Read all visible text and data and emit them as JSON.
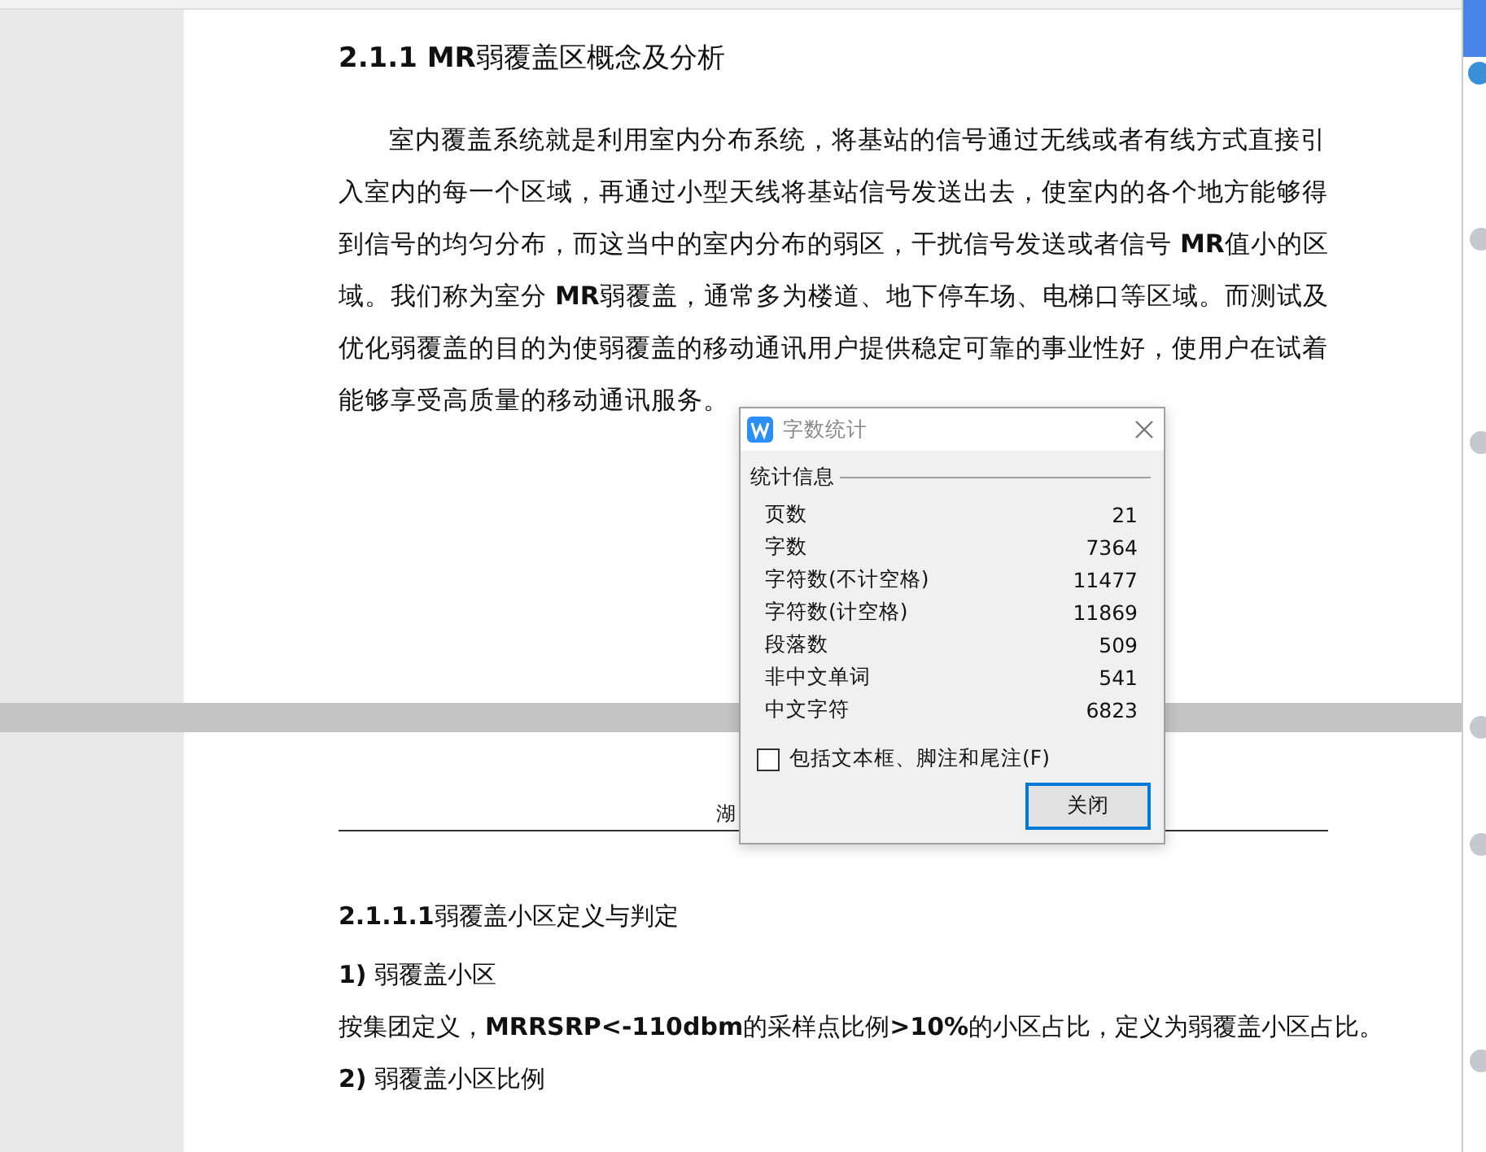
{
  "page_1": {
    "heading": "**2.1.1 MR**弱覆盖区概念及分析",
    "paragraph": [
      "室内覆盖系统就是利用室内分布系统，将基站的信号通过无线或者有线方式直接引",
      "入室内的每一个区域，再通过小型天线将基站信号发送出去，使室内的各个地方能够得",
      "到信号的均匀分布，而这当中的室内分布的弱区，干扰信号发送或者信号 **MR**值小的区",
      "域。我们称为室分 **MR**弱覆盖，通常多为楼道、地下停车场、电梯口等区域。而测试及",
      "优化弱覆盖的目的为使弱覆盖的移动通讯用户提供稳定可靠的事业性好，使用户在试着",
      "能够享受高质量的移动通讯服务。"
    ]
  },
  "page_2": {
    "header": "湖",
    "blocks": [
      {
        "kind": "heading",
        "text": "**2.1.1.1**弱覆盖小区定义与判定"
      },
      {
        "kind": "item",
        "text": "**1)** 弱覆盖小区"
      },
      {
        "kind": "body",
        "text": "按集团定义，**MRRSRP<-110dbm**的采样点比例**>10%**的小区占比，定义为弱覆盖小区占比。"
      },
      {
        "kind": "item",
        "text": "**2)** 弱覆盖小区比例"
      }
    ]
  },
  "dialog": {
    "title": "字数统计",
    "group": "统计信息",
    "rows": [
      {
        "label": "页数",
        "value": "21"
      },
      {
        "label": "字数",
        "value": "7364"
      },
      {
        "label": "字符数(不计空格)",
        "value": "11477"
      },
      {
        "label": "字符数(计空格)",
        "value": "11869"
      },
      {
        "label": "段落数",
        "value": "509"
      },
      {
        "label": "非中文单词",
        "value": "541"
      },
      {
        "label": "中文字符",
        "value": "6823"
      }
    ],
    "checkbox": {
      "label": "包括文本框、脚注和尾注(F)",
      "checked": false
    },
    "button": "关闭"
  }
}
